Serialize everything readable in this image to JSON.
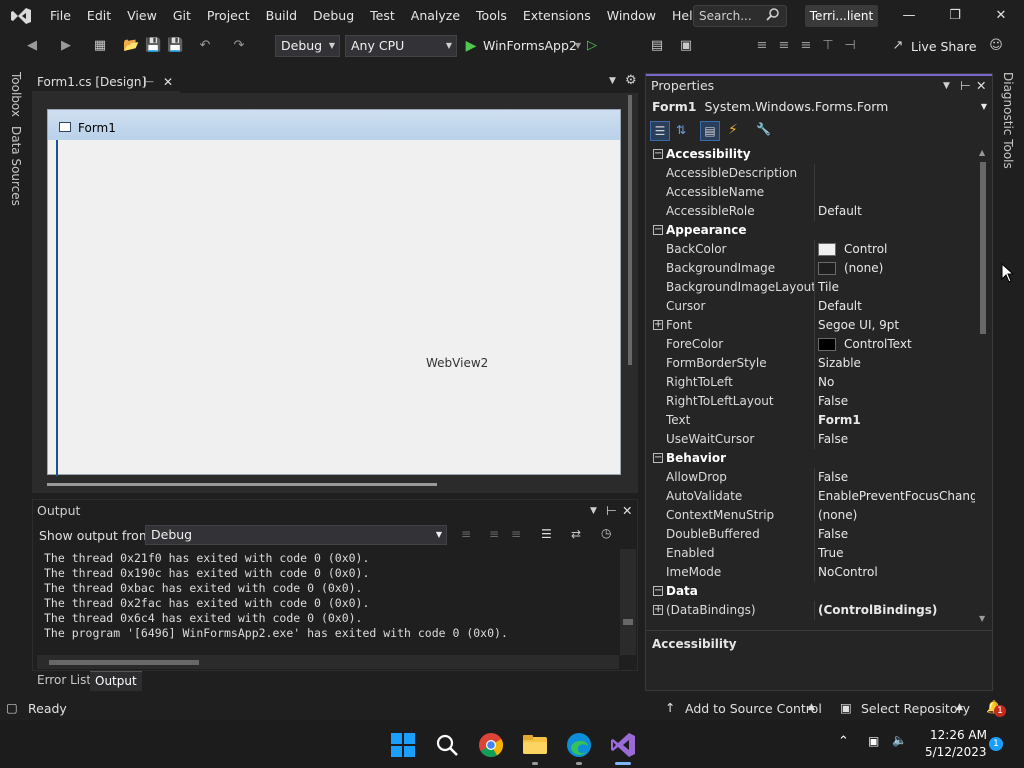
{
  "menubar": {
    "items": [
      "File",
      "Edit",
      "View",
      "Git",
      "Project",
      "Build",
      "Debug",
      "Test",
      "Analyze",
      "Tools",
      "Extensions",
      "Window",
      "Help"
    ],
    "search_placeholder": "Search...",
    "solution_badge": "Terri...lient"
  },
  "toolbar": {
    "config": "Debug",
    "platform": "Any CPU",
    "run_target": "WinFormsApp2",
    "live_share": "Live Share"
  },
  "side_tabs": {
    "left": [
      "Toolbox",
      "Data Sources"
    ],
    "right": [
      "Diagnostic Tools"
    ]
  },
  "designer": {
    "tab_label": "Form1.cs [Design]",
    "form_title": "Form1",
    "webview_label": "WebView2"
  },
  "output": {
    "title": "Output",
    "show_from_label": "Show output from:",
    "source": "Debug",
    "lines": [
      "The thread 0x21f0 has exited with code 0 (0x0).",
      "The thread 0x190c has exited with code 0 (0x0).",
      "The thread 0xbac has exited with code 0 (0x0).",
      "The thread 0x2fac has exited with code 0 (0x0).",
      "The thread 0x6c4 has exited with code 0 (0x0).",
      "The program '[6496] WinFormsApp2.exe' has exited with code 0 (0x0)."
    ]
  },
  "bottom_tabs": [
    "Error List",
    "Output"
  ],
  "properties": {
    "title": "Properties",
    "object_name": "Form1",
    "object_type": "System.Windows.Forms.Form",
    "rows": [
      {
        "kind": "cat",
        "name": "Accessibility"
      },
      {
        "kind": "prop",
        "name": "AccessibleDescription",
        "value": ""
      },
      {
        "kind": "prop",
        "name": "AccessibleName",
        "value": ""
      },
      {
        "kind": "prop",
        "name": "AccessibleRole",
        "value": "Default"
      },
      {
        "kind": "cat",
        "name": "Appearance"
      },
      {
        "kind": "prop",
        "name": "BackColor",
        "value": "Control",
        "swatch": "#f0f0f0"
      },
      {
        "kind": "prop",
        "name": "BackgroundImage",
        "value": "(none)",
        "swatch": "#1e1e1e"
      },
      {
        "kind": "prop",
        "name": "BackgroundImageLayout",
        "value": "Tile"
      },
      {
        "kind": "prop",
        "name": "Cursor",
        "value": "Default"
      },
      {
        "kind": "prop",
        "name": "Font",
        "value": "Segoe UI, 9pt",
        "expand": true
      },
      {
        "kind": "prop",
        "name": "ForeColor",
        "value": "ControlText",
        "swatch": "#000000"
      },
      {
        "kind": "prop",
        "name": "FormBorderStyle",
        "value": "Sizable"
      },
      {
        "kind": "prop",
        "name": "RightToLeft",
        "value": "No"
      },
      {
        "kind": "prop",
        "name": "RightToLeftLayout",
        "value": "False"
      },
      {
        "kind": "prop",
        "name": "Text",
        "value": "Form1",
        "bold": true
      },
      {
        "kind": "prop",
        "name": "UseWaitCursor",
        "value": "False"
      },
      {
        "kind": "cat",
        "name": "Behavior"
      },
      {
        "kind": "prop",
        "name": "AllowDrop",
        "value": "False"
      },
      {
        "kind": "prop",
        "name": "AutoValidate",
        "value": "EnablePreventFocusChange"
      },
      {
        "kind": "prop",
        "name": "ContextMenuStrip",
        "value": "(none)"
      },
      {
        "kind": "prop",
        "name": "DoubleBuffered",
        "value": "False"
      },
      {
        "kind": "prop",
        "name": "Enabled",
        "value": "True"
      },
      {
        "kind": "prop",
        "name": "ImeMode",
        "value": "NoControl"
      },
      {
        "kind": "cat",
        "name": "Data"
      },
      {
        "kind": "prop",
        "name": "(DataBindings)",
        "value": "(ControlBindings)",
        "bold": true,
        "expand": true
      }
    ],
    "description_title": "Accessibility"
  },
  "statusbar": {
    "ready": "Ready",
    "source_control": "Add to Source Control",
    "repository": "Select Repository",
    "notification_count": "1"
  },
  "taskbar": {
    "time": "12:26 AM",
    "date": "5/12/2023",
    "badge": "1"
  }
}
